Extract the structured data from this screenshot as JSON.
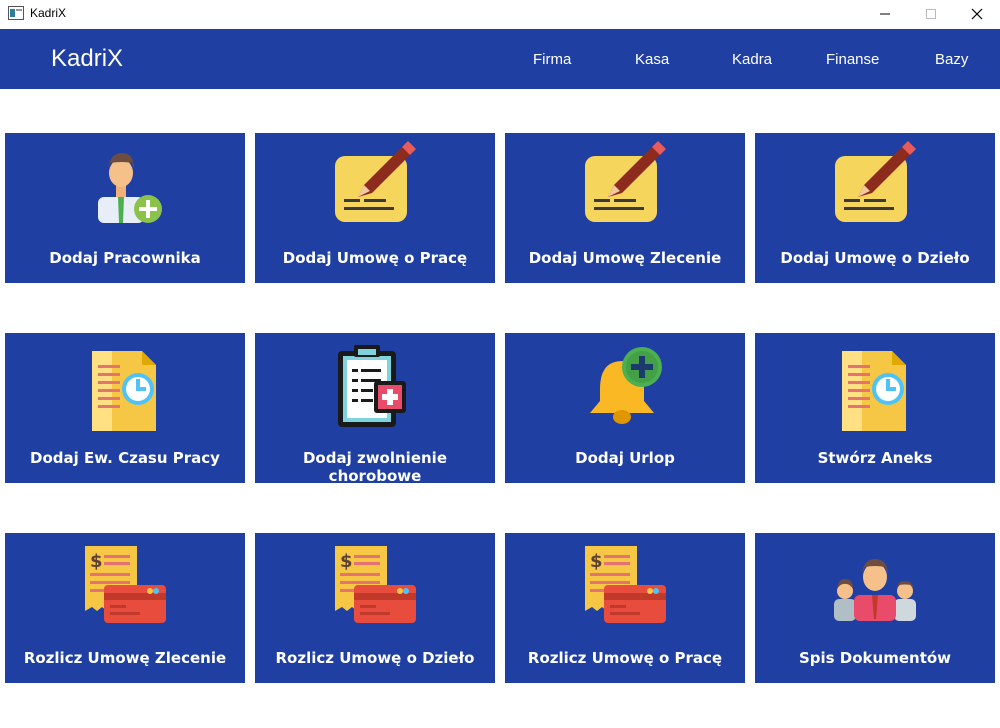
{
  "window": {
    "title": "KadriX"
  },
  "navbar": {
    "brand": "KadriX",
    "items": [
      {
        "label": "Firma"
      },
      {
        "label": "Kasa"
      },
      {
        "label": "Kadra"
      },
      {
        "label": "Finanse"
      },
      {
        "label": "Bazy"
      }
    ]
  },
  "tiles": [
    {
      "label": "Dodaj Pracownika",
      "icon": "add-employee-icon"
    },
    {
      "label": "Dodaj Umowę o Pracę",
      "icon": "notepad-pencil-icon"
    },
    {
      "label": "Dodaj Umowę Zlecenie",
      "icon": "notepad-pencil-icon"
    },
    {
      "label": "Dodaj Umowę o Dzieło",
      "icon": "notepad-pencil-icon"
    },
    {
      "label": "Dodaj Ew. Czasu Pracy",
      "icon": "document-clock-icon"
    },
    {
      "label": "Dodaj zwolnienie chorobowe",
      "icon": "medical-clipboard-icon"
    },
    {
      "label": "Dodaj Urlop",
      "icon": "bell-add-icon"
    },
    {
      "label": "Stwórz Aneks",
      "icon": "document-clock-icon"
    },
    {
      "label": "Rozlicz Umowę Zlecenie",
      "icon": "receipt-card-icon"
    },
    {
      "label": "Rozlicz Umowę o Dzieło",
      "icon": "receipt-card-icon"
    },
    {
      "label": "Rozlicz Umowę o Pracę",
      "icon": "receipt-card-icon"
    },
    {
      "label": "Spis Dokumentów",
      "icon": "people-group-icon"
    }
  ],
  "colors": {
    "accent": "#1f3fa3",
    "background": "#ffffff",
    "text_on_accent": "#ffffff"
  }
}
